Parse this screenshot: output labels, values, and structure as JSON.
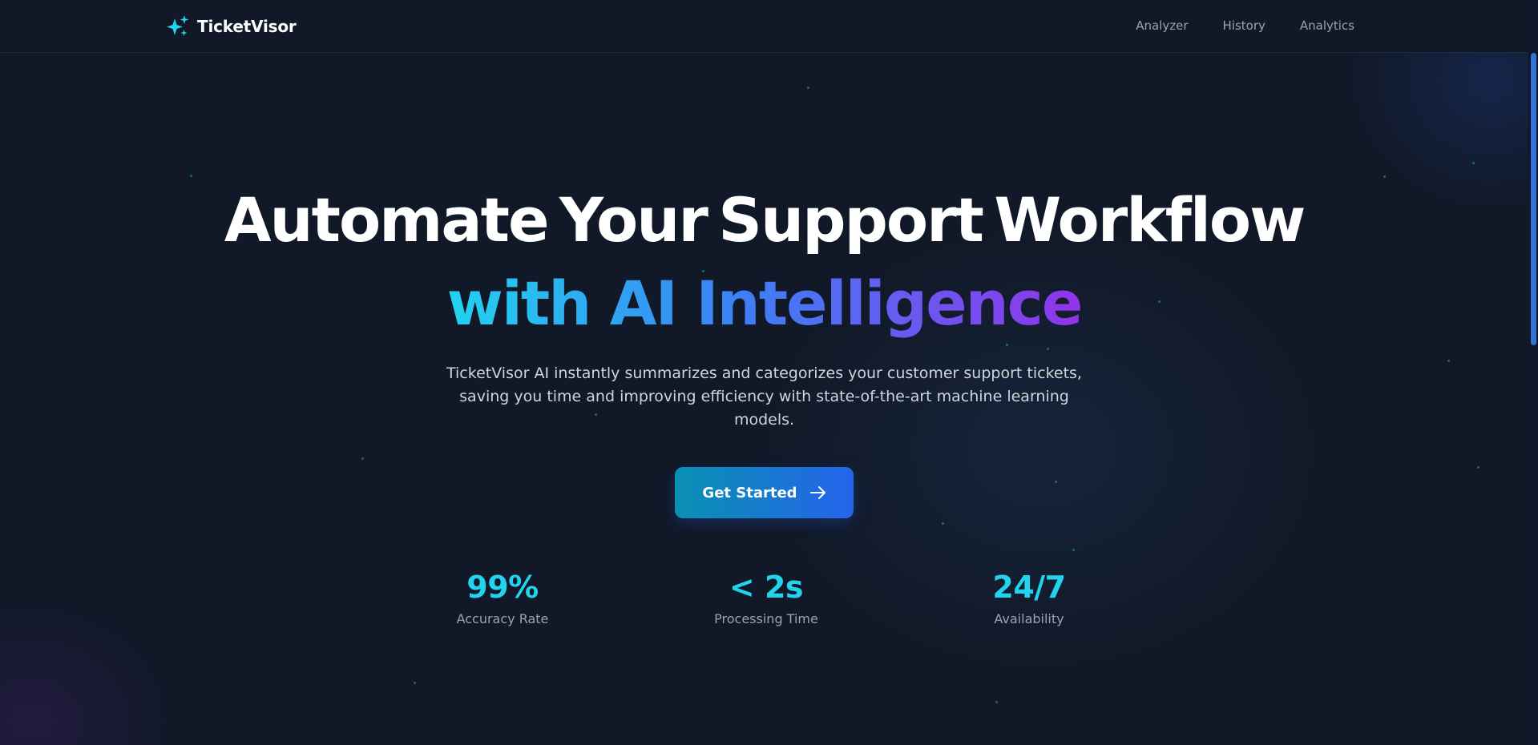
{
  "app": {
    "brand_name": "TicketVisor",
    "brand_icon": "sparkles-icon",
    "accent_color": "#22d3ee"
  },
  "nav": {
    "links": [
      {
        "label": "Analyzer"
      },
      {
        "label": "History"
      },
      {
        "label": "Analytics"
      }
    ]
  },
  "hero": {
    "headline_line1": "Automate Your Support Workflow",
    "headline_line2": "with AI Intelligence",
    "description": "TicketVisor AI instantly summarizes and categorizes your customer support tickets, saving you time and improving efficiency with state-of-the-art machine learning models.",
    "cta_label": "Get Started",
    "cta_icon": "arrow-right-icon",
    "gradient_colors": [
      "#22d3ee",
      "#3b82f6",
      "#9333ea"
    ]
  },
  "stats": [
    {
      "value": "99%",
      "label": "Accuracy Rate"
    },
    {
      "value": "< 2s",
      "label": "Processing Time"
    },
    {
      "value": "24/7",
      "label": "Availability"
    }
  ]
}
